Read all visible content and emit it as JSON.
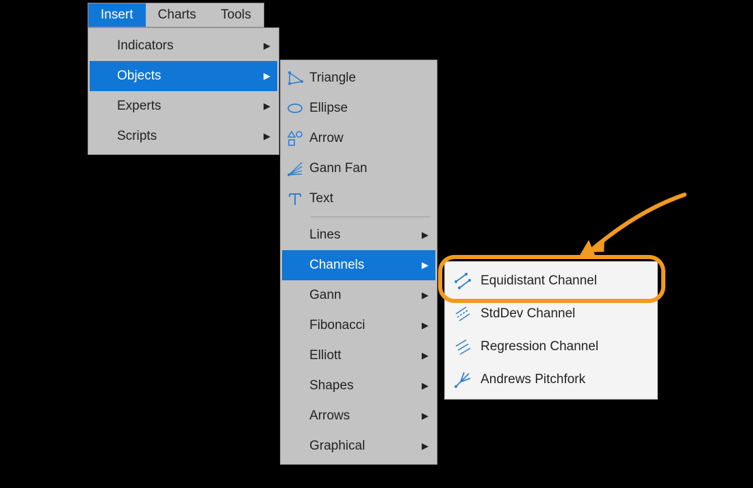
{
  "colors": {
    "accent": "#1177d7",
    "highlight": "#f29a1f",
    "menu_bg": "#c3c3c3",
    "submenu_bg": "#f4f4f4",
    "icon_blue": "#2d7fd1"
  },
  "menubar": {
    "items": [
      {
        "label": "Insert",
        "active": true
      },
      {
        "label": "Charts",
        "active": false
      },
      {
        "label": "Tools",
        "active": false
      }
    ]
  },
  "menu_insert": {
    "items": [
      {
        "label": "Indicators",
        "hasSubmenu": true
      },
      {
        "label": "Objects",
        "hasSubmenu": true,
        "selected": true
      },
      {
        "label": "Experts",
        "hasSubmenu": true
      },
      {
        "label": "Scripts",
        "hasSubmenu": true
      }
    ]
  },
  "menu_objects": {
    "top_items": [
      {
        "label": "Triangle",
        "icon": "triangle-icon"
      },
      {
        "label": "Ellipse",
        "icon": "ellipse-icon"
      },
      {
        "label": "Arrow",
        "icon": "shapes-icon"
      },
      {
        "label": "Gann Fan",
        "icon": "gann-fan-icon"
      },
      {
        "label": "Text",
        "icon": "text-icon"
      }
    ],
    "sub_items": [
      {
        "label": "Lines",
        "hasSubmenu": true
      },
      {
        "label": "Channels",
        "hasSubmenu": true,
        "selected": true
      },
      {
        "label": "Gann",
        "hasSubmenu": true
      },
      {
        "label": "Fibonacci",
        "hasSubmenu": true
      },
      {
        "label": "Elliott",
        "hasSubmenu": true
      },
      {
        "label": "Shapes",
        "hasSubmenu": true
      },
      {
        "label": "Arrows",
        "hasSubmenu": true
      },
      {
        "label": "Graphical",
        "hasSubmenu": true
      }
    ]
  },
  "menu_channels": {
    "items": [
      {
        "label": "Equidistant Channel",
        "icon": "equidistant-channel-icon",
        "highlighted": true
      },
      {
        "label": "StdDev Channel",
        "icon": "stddev-channel-icon"
      },
      {
        "label": "Regression Channel",
        "icon": "regression-channel-icon"
      },
      {
        "label": "Andrews Pitchfork",
        "icon": "andrews-pitchfork-icon"
      }
    ]
  }
}
